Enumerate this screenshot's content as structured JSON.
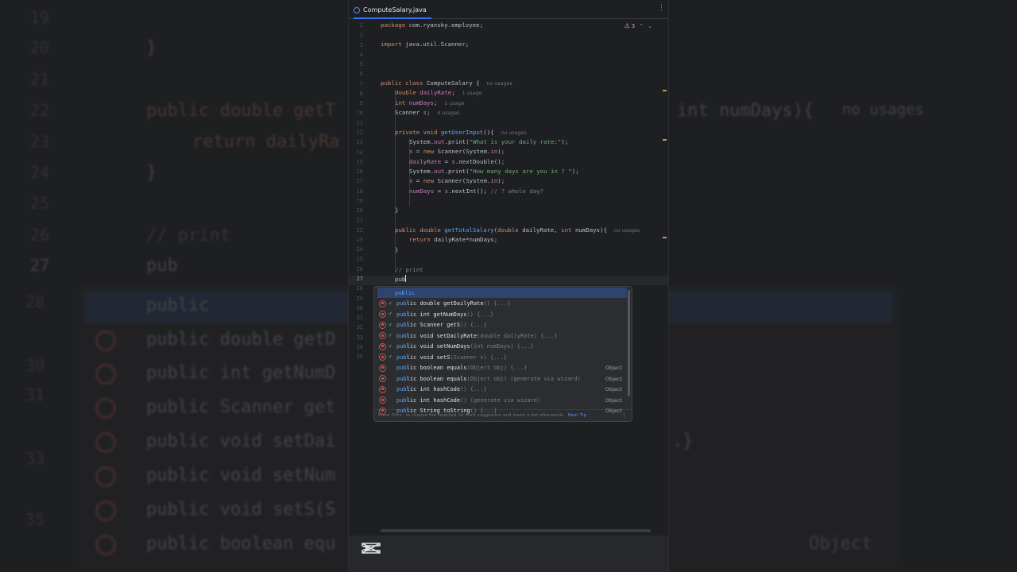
{
  "editor": {
    "tab": {
      "file_name": "ComputeSalary.java",
      "icon": "class-icon"
    },
    "more_options_icon": "kebab-icon",
    "inspection": {
      "warnings_count": "3",
      "icon": "warning-triangle-icon",
      "expand_icon": "chevron-down-icon"
    },
    "current_line": 27,
    "line_numbers": [
      "1",
      "2",
      "3",
      "4",
      "5",
      "6",
      "7",
      "8",
      "9",
      "10",
      "11",
      "12",
      "13",
      "14",
      "15",
      "16",
      "17",
      "18",
      "19",
      "20",
      "21",
      "22",
      "23",
      "24",
      "25",
      "26",
      "27",
      "28",
      "29",
      "30",
      "31",
      "32",
      "33",
      "34",
      "35"
    ],
    "code": {
      "l1": {
        "kw": "package",
        "rest": " com.ryansky.employee;"
      },
      "l3": {
        "kw": "import",
        "rest": " java.util.Scanner;"
      },
      "l7": {
        "kw": "public class",
        "name": " ComputeSalary",
        "rest": " {",
        "hint": "no usages"
      },
      "l8": {
        "kw": "double",
        "fld": " dailyRate",
        "rest": ";",
        "hint": "1 usage"
      },
      "l9": {
        "kw": "int",
        "fld": " numDays",
        "rest": ";",
        "hint": "1 usage"
      },
      "l10": {
        "kw": "Scanner",
        "fld": " s",
        "rest": ";",
        "hint": "4 usages"
      },
      "l12": {
        "kw": "private void",
        "fn": " getUserInput",
        "rest": "(){",
        "hint": "no usages"
      },
      "l13": {
        "a": "System.",
        "b": "out",
        "c": ".print(",
        "str": "\"What is your daily rate:\"",
        "d": ");"
      },
      "l14": {
        "fld": "s",
        "a": " = ",
        "kw": "new",
        "b": " Scanner(System.",
        "c": "in",
        "d": ");"
      },
      "l15": {
        "fld": "dailyRate",
        "a": " = ",
        "fld2": "s",
        "b": ".nextDouble();"
      },
      "l16": {
        "a": "System.",
        "b": "out",
        "c": ".print(",
        "str": "\"How many days are you in ? \"",
        "d": ");"
      },
      "l17": {
        "fld": "s",
        "a": " = ",
        "kw": "new",
        "b": " Scanner(System.",
        "c": "in",
        "d": ");"
      },
      "l18": {
        "fld": "numDays",
        "a": " = ",
        "fld2": "s",
        "b": ".nextInt(); ",
        "cm": "// ? whole day?"
      },
      "l20": {
        "rest": "}"
      },
      "l22": {
        "kw": "public double",
        "fn": " getTotalSalary",
        "a": "(",
        "kw2": "double",
        "b": " dailyRate, ",
        "kw3": "int",
        "c": " numDays){",
        "hint": "no usages"
      },
      "l23": {
        "kw": "return",
        "rest": " dailyRate*numDays;"
      },
      "l24": {
        "rest": "}"
      },
      "l26": {
        "cm": "// print"
      },
      "l27": {
        "typed": "pub"
      }
    }
  },
  "completion": {
    "items": [
      {
        "bold": "pub",
        "rest": "lic",
        "sig": "",
        "type": ""
      },
      {
        "bold": "pub",
        "rest": "lic double getDailyRate",
        "sig": "() {...}",
        "type": ""
      },
      {
        "bold": "pub",
        "rest": "lic int getNumDays",
        "sig": "() {...}",
        "type": ""
      },
      {
        "bold": "pub",
        "rest": "lic Scanner getS",
        "sig": "() {...}",
        "type": ""
      },
      {
        "bold": "pub",
        "rest": "lic void setDailyRate",
        "sig": "(double dailyRate) {...}",
        "type": ""
      },
      {
        "bold": "pub",
        "rest": "lic void setNumDays",
        "sig": "(int numDays) {...}",
        "type": ""
      },
      {
        "bold": "pub",
        "rest": "lic void setS",
        "sig": "(Scanner s) {...}",
        "type": ""
      },
      {
        "bold": "pub",
        "rest": "lic boolean equals",
        "sig": "(Object obj) {...}",
        "type": "Object"
      },
      {
        "bold": "pub",
        "rest": "lic boolean equals",
        "sig": "(Object obj) (generate via wizard)",
        "type": "Object"
      },
      {
        "bold": "pub",
        "rest": "lic int hashCode",
        "sig": "() {...}",
        "type": "Object"
      },
      {
        "bold": "pub",
        "rest": "lic int hashCode",
        "sig": "() (generate via wizard)",
        "type": "Object"
      },
      {
        "bold": "pub",
        "rest": "lic String toString",
        "sig": "() {...}",
        "type": "Object"
      }
    ],
    "footer_tip": "Press Ctrl+. to choose the selected (or first) suggestion and insert a dot afterwards.",
    "next_tip": "Next Tip",
    "more_icon": "kebab-icon"
  },
  "background": {
    "line_numbers": [
      "19",
      "20",
      "21",
      "22",
      "23",
      "24",
      "25",
      "26",
      "27",
      "28",
      "29",
      "30",
      "31",
      "32",
      "33",
      "34",
      "35"
    ],
    "brace": "}",
    "l22_a": "public double getT",
    "l22_b": "int numDays){",
    "l22_hint": "no usages",
    "l23": "return dailyRa",
    "l26": "// print",
    "l27": "pub",
    "popup_rows": [
      "public",
      "public double getD",
      "public int getNumD",
      "public Scanner get",
      "public void setDai",
      "public void setNum",
      "public void setS(S",
      "public boolean equ"
    ],
    "right_fragment": ".}",
    "object_label": "Object"
  },
  "watermark": {
    "icon": "capcut-logo-icon"
  }
}
